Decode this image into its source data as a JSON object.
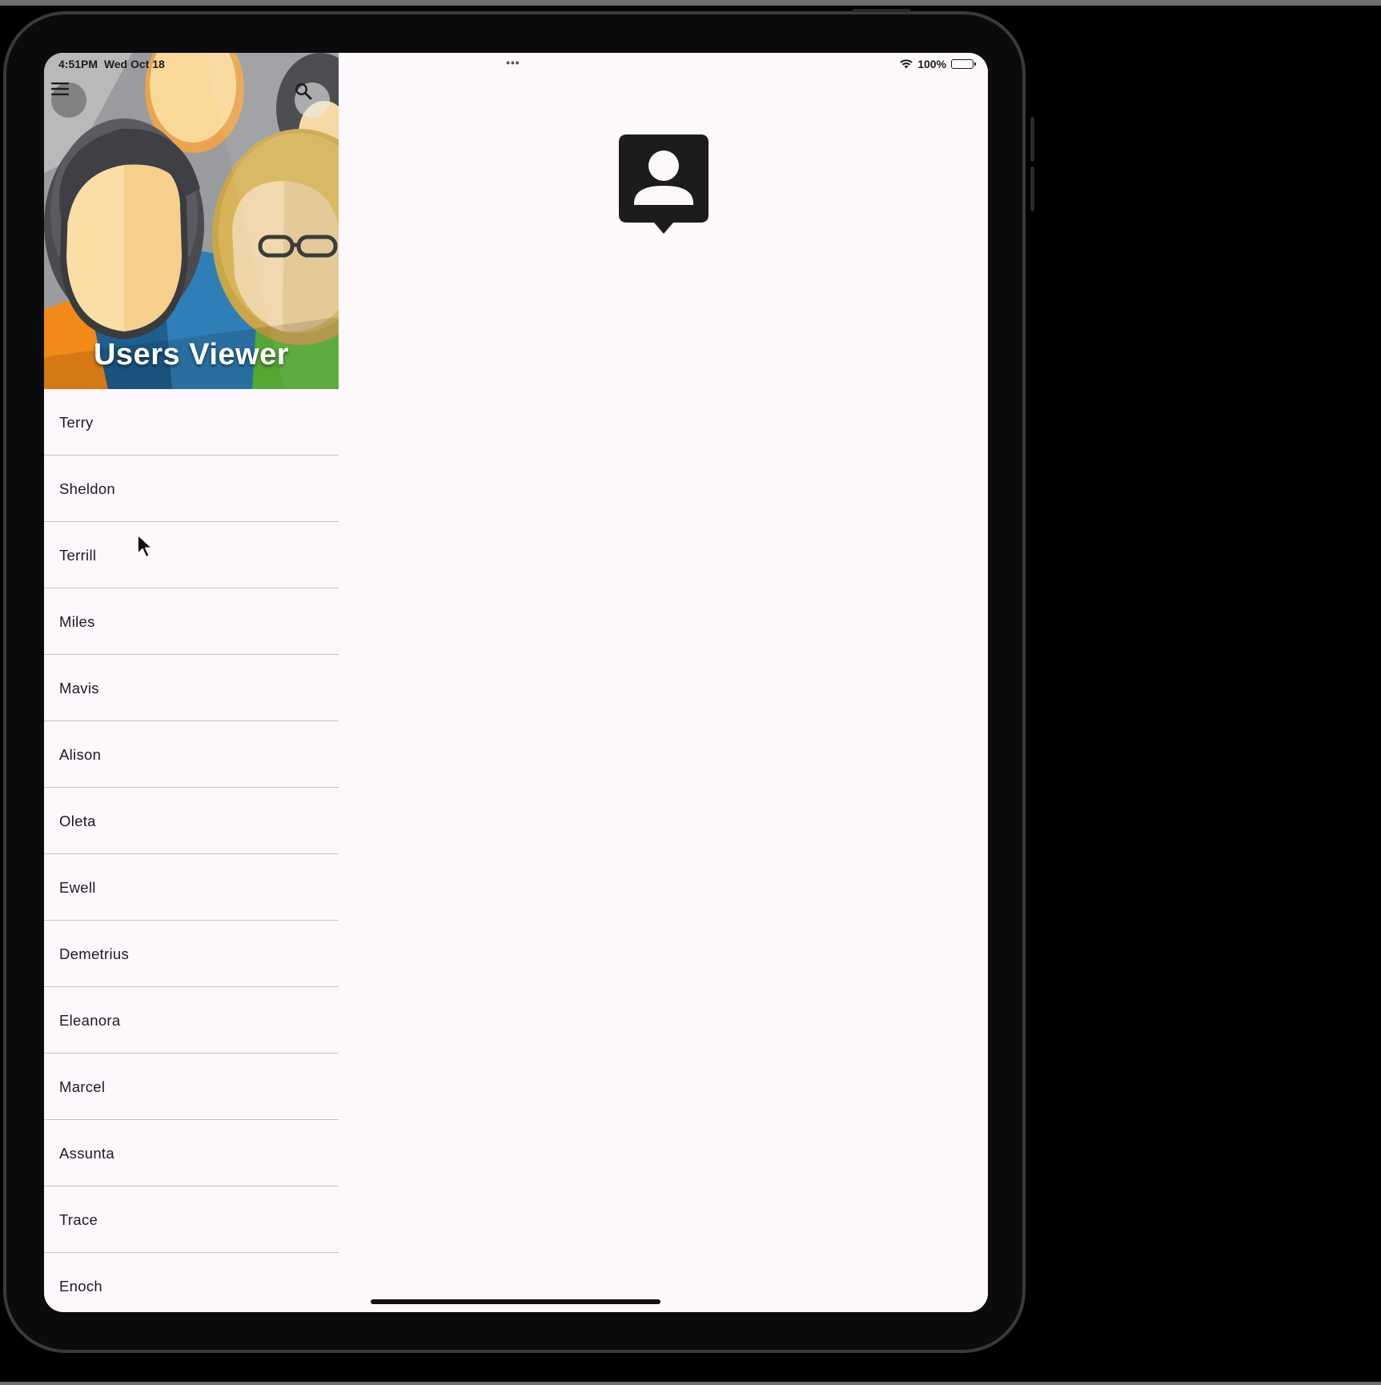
{
  "status_bar": {
    "time": "4:51PM",
    "date": "Wed Oct 18",
    "battery": "100%",
    "multitask_dots": "•••"
  },
  "app": {
    "title": "Users Viewer"
  },
  "header": {
    "menu_icon": "hamburger-menu-icon",
    "search_icon": "search-icon"
  },
  "users": [
    {
      "name": "Terry"
    },
    {
      "name": "Sheldon"
    },
    {
      "name": "Terrill"
    },
    {
      "name": "Miles"
    },
    {
      "name": "Mavis"
    },
    {
      "name": "Alison"
    },
    {
      "name": "Oleta"
    },
    {
      "name": "Ewell"
    },
    {
      "name": "Demetrius"
    },
    {
      "name": "Eleanora"
    },
    {
      "name": "Marcel"
    },
    {
      "name": "Assunta"
    },
    {
      "name": "Trace"
    },
    {
      "name": "Enoch"
    }
  ],
  "detail": {
    "placeholder_icon": "contact-person-icon"
  },
  "colors": {
    "background": "#fdf8fc",
    "divider": "#c4c4c4",
    "text": "#1d1b20",
    "device_frame": "#0b0b0b"
  }
}
